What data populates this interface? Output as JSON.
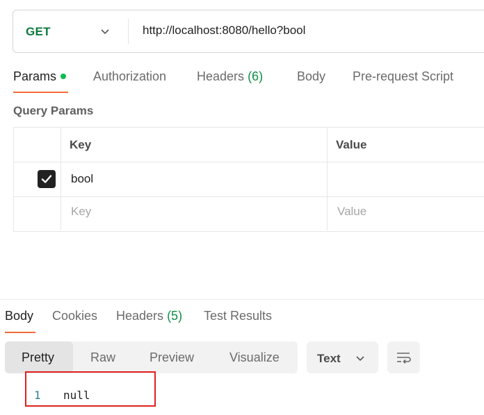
{
  "request": {
    "method": "GET",
    "url": "http://localhost:8080/hello?bool"
  },
  "request_tabs": [
    {
      "label": "Params",
      "active": true,
      "has_dot": true
    },
    {
      "label": "Authorization"
    },
    {
      "label": "Headers",
      "count": "(6)"
    },
    {
      "label": "Body"
    },
    {
      "label": "Pre-request Script"
    }
  ],
  "query_params": {
    "title": "Query Params",
    "columns": {
      "key": "Key",
      "value": "Value"
    },
    "rows": [
      {
        "checked": true,
        "key": "bool",
        "value": ""
      }
    ],
    "new_row": {
      "key_placeholder": "Key",
      "value_placeholder": "Value"
    }
  },
  "response_tabs": [
    {
      "label": "Body",
      "active": true
    },
    {
      "label": "Cookies"
    },
    {
      "label": "Headers",
      "count": "(5)"
    },
    {
      "label": "Test Results"
    }
  ],
  "view_modes": [
    {
      "label": "Pretty",
      "active": true
    },
    {
      "label": "Raw"
    },
    {
      "label": "Preview"
    },
    {
      "label": "Visualize"
    }
  ],
  "format": {
    "selected": "Text"
  },
  "icons": {
    "chevron": "chevron-down-icon",
    "wrap": "wrap-lines-icon",
    "check": "check-icon"
  },
  "colors": {
    "accent": "#f26b3a",
    "method_get": "#0c7a3e",
    "count": "#0c8f45",
    "highlight": "#e02020"
  },
  "response_body": {
    "lines": [
      {
        "number": "1",
        "text": "null"
      }
    ]
  }
}
